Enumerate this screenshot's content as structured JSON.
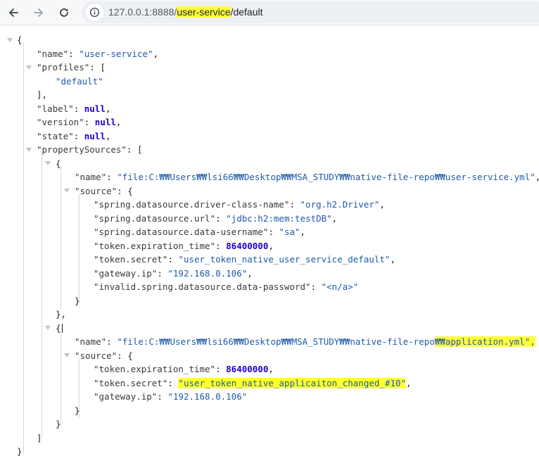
{
  "browser": {
    "url_host": "127.0.0.1:8888/",
    "url_path": "user-service",
    "url_suffix": "/default",
    "icons": {
      "back": "arrow-left-icon",
      "forward": "arrow-right-icon",
      "reload": "reload-icon",
      "site_info": "info-icon"
    }
  },
  "json": {
    "name": "\"user-service\"",
    "profiles": [
      "\"default\""
    ],
    "label": "null",
    "version": "null",
    "state": "null",
    "propertySources": [
      {
        "name": "\"file:C:₩₩Users₩₩lsi66₩₩Desktop₩₩MSA_STUDY₩₩native-file-repo₩₩user-service.yml\"",
        "source": [
          {
            "key": "\"spring.datasource.driver-class-name\"",
            "value": "\"org.h2.Driver\"",
            "type": "string"
          },
          {
            "key": "\"spring.datasource.url\"",
            "value": "\"jdbc:h2:mem:testDB\"",
            "type": "string"
          },
          {
            "key": "\"spring.datasource.data-username\"",
            "value": "\"sa\"",
            "type": "string"
          },
          {
            "key": "\"token.expiration_time\"",
            "value": "86400000",
            "type": "number"
          },
          {
            "key": "\"token.secret\"",
            "value": "\"user_token_native_user_service_default\"",
            "type": "string"
          },
          {
            "key": "\"gateway.ip\"",
            "value": "\"192.168.0.106\"",
            "type": "string"
          },
          {
            "key": "\"invalid.spring.datasource.data-password\"",
            "value": "\"<n/a>\"",
            "type": "string"
          }
        ]
      },
      {
        "name_prefix": "\"file:C:₩₩Users₩₩lsi66₩₩Desktop₩₩MSA_STUDY₩₩native-file-repo",
        "name_highlight": "₩₩application.yml\",",
        "source": [
          {
            "key": "\"token.expiration_time\"",
            "value": "86400000",
            "type": "number"
          },
          {
            "key": "\"token.secret\"",
            "value": "\"user_token_native_applicaiton_changed_#10\"",
            "type": "string",
            "highlight": true
          },
          {
            "key": "\"gateway.ip\"",
            "value": "\"192.168.0.106\"",
            "type": "string"
          }
        ]
      }
    ]
  }
}
